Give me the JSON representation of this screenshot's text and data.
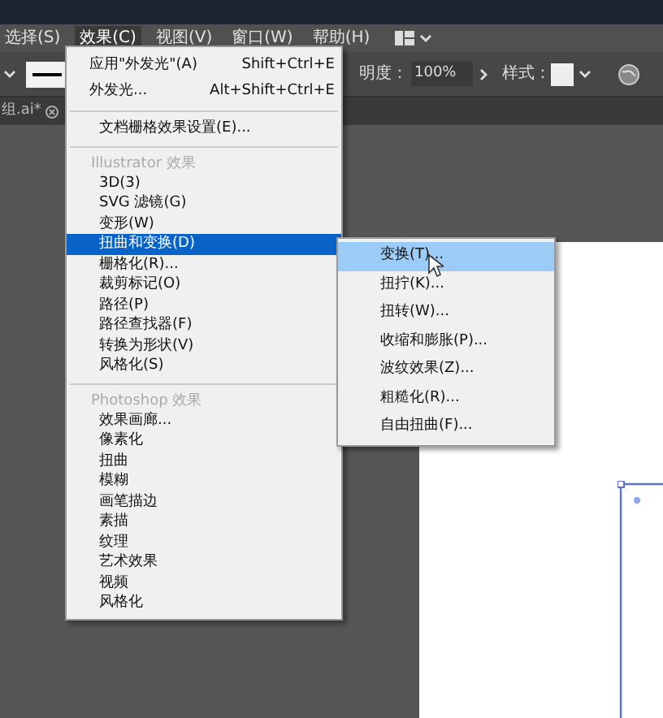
{
  "menu_bar": [
    {
      "label": "选择(S)",
      "selected": false
    },
    {
      "label": "效果(C)",
      "selected": true
    },
    {
      "label": "视图(V)",
      "selected": false
    },
    {
      "label": "窗口(W)",
      "selected": false
    },
    {
      "label": "帮助(H)",
      "selected": false
    }
  ],
  "control_bar": {
    "opacity_label": "明度：",
    "opacity_value": "100%",
    "style_label": "样式："
  },
  "document_tab": {
    "title": "组.ai*"
  },
  "effect_menu": [
    {
      "kind": "item",
      "label": "应用\"外发光\"(A)",
      "shortcut": "Shift+Ctrl+E",
      "selected": false
    },
    {
      "kind": "item",
      "label": "外发光...",
      "shortcut": "Alt+Shift+Ctrl+E",
      "selected": false
    },
    {
      "kind": "separator"
    },
    {
      "kind": "item",
      "label": "文档栅格效果设置(E)...",
      "selected": false
    },
    {
      "kind": "separator"
    },
    {
      "kind": "header",
      "label": "Illustrator 效果"
    },
    {
      "kind": "item",
      "label": "3D(3)",
      "selected": false
    },
    {
      "kind": "item",
      "label": "SVG 滤镜(G)",
      "selected": false
    },
    {
      "kind": "item",
      "label": "变形(W)",
      "selected": false
    },
    {
      "kind": "item",
      "label": "扭曲和变换(D)",
      "selected": true
    },
    {
      "kind": "item",
      "label": "栅格化(R)...",
      "selected": false
    },
    {
      "kind": "item",
      "label": "裁剪标记(O)",
      "selected": false
    },
    {
      "kind": "item",
      "label": "路径(P)",
      "selected": false
    },
    {
      "kind": "item",
      "label": "路径查找器(F)",
      "selected": false
    },
    {
      "kind": "item",
      "label": "转换为形状(V)",
      "selected": false
    },
    {
      "kind": "item",
      "label": "风格化(S)",
      "selected": false
    },
    {
      "kind": "separator"
    },
    {
      "kind": "header",
      "label": "Photoshop 效果"
    },
    {
      "kind": "item",
      "label": "效果画廊...",
      "selected": false
    },
    {
      "kind": "item",
      "label": "像素化",
      "selected": false
    },
    {
      "kind": "item",
      "label": "扭曲",
      "selected": false
    },
    {
      "kind": "item",
      "label": "模糊",
      "selected": false
    },
    {
      "kind": "item",
      "label": "画笔描边",
      "selected": false
    },
    {
      "kind": "item",
      "label": "素描",
      "selected": false
    },
    {
      "kind": "item",
      "label": "纹理",
      "selected": false
    },
    {
      "kind": "item",
      "label": "艺术效果",
      "selected": false
    },
    {
      "kind": "item",
      "label": "视频",
      "selected": false
    },
    {
      "kind": "item",
      "label": "风格化",
      "selected": false
    }
  ],
  "submenu": [
    {
      "label": "变换(T)...",
      "selected": true
    },
    {
      "label": "扭拧(K)...",
      "selected": false
    },
    {
      "label": "扭转(W)...",
      "selected": false
    },
    {
      "label": "收缩和膨胀(P)...",
      "selected": false
    },
    {
      "label": "波纹效果(Z)...",
      "selected": false
    },
    {
      "label": "粗糙化(R)...",
      "selected": false
    },
    {
      "label": "自由扭曲(F)...",
      "selected": false
    }
  ]
}
